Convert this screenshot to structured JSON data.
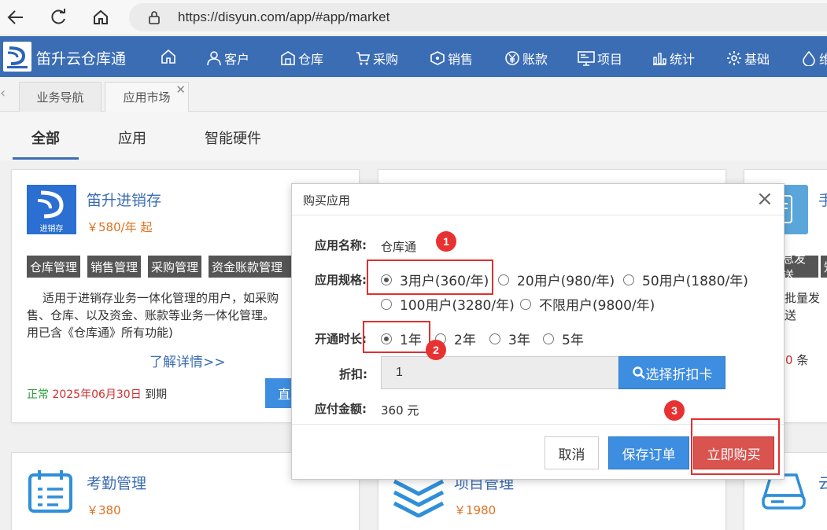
{
  "browser": {
    "url": "https://disyun.com/app/#app/market"
  },
  "header": {
    "brand": "笛升云仓库通",
    "nav": [
      {
        "label": ""
      },
      {
        "label": "客户"
      },
      {
        "label": "仓库"
      },
      {
        "label": "采购"
      },
      {
        "label": "销售"
      },
      {
        "label": "账款"
      },
      {
        "label": "项目"
      },
      {
        "label": "统计"
      },
      {
        "label": "基础"
      },
      {
        "label": "维"
      }
    ]
  },
  "tabs": [
    {
      "label": "业务导航"
    },
    {
      "label": "应用市场"
    }
  ],
  "categories": [
    {
      "label": "全部"
    },
    {
      "label": "应用"
    },
    {
      "label": "智能硬件"
    }
  ],
  "cards": {
    "jxc": {
      "title": "笛升进销存",
      "logo_text": "进销存",
      "price": "￥580/年 起",
      "tags": [
        "仓库管理",
        "销售管理",
        "采购管理",
        "资金账款管理"
      ],
      "desc_lines": [
        "适用于进销存业务一体化管理的用户，如采购",
        "售、仓库、以及资金、账款等业务一体化管理。",
        "用已含《仓库通》所有功能)"
      ],
      "detail": "了解详情>>",
      "status_normal": "正常",
      "status_date": "2025年06月30日",
      "status_suffix": "到期",
      "btn_partial": "直"
    },
    "right_top": {
      "title_partial": "手",
      "tag_partial1": "息发送",
      "tag_partial2": "知",
      "desc_partial": "批量发送",
      "count_num": "0",
      "count_unit": "条"
    },
    "kq": {
      "title": "考勤管理",
      "price": "￥380"
    },
    "xm": {
      "title": "项目管理",
      "price": "￥1980"
    },
    "right_bottom": {
      "title_partial": "云"
    }
  },
  "modal": {
    "title": "购买应用",
    "close": "×",
    "app_name_label": "应用名称:",
    "app_name_value": "仓库通",
    "spec_label": "应用规格:",
    "specs": [
      {
        "label": "3用户(360/年)",
        "checked": true
      },
      {
        "label": "20用户(980/年)",
        "checked": false
      },
      {
        "label": "50用户(1880/年)",
        "checked": false
      },
      {
        "label": "100用户(3280/年)",
        "checked": false
      },
      {
        "label": "不限用户(9800/年)",
        "checked": false
      }
    ],
    "duration_label": "开通时长:",
    "durations": [
      {
        "label": "1年",
        "checked": true
      },
      {
        "label": "2年",
        "checked": false
      },
      {
        "label": "3年",
        "checked": false
      },
      {
        "label": "5年",
        "checked": false
      }
    ],
    "discount_label": "折扣:",
    "discount_value": "1",
    "discount_button": "选择折扣卡",
    "amount_label": "应付金额:",
    "amount_value": "360 元",
    "cancel": "取消",
    "save": "保存订单",
    "buy": "立即购买"
  },
  "annotations": {
    "m1": "1",
    "m2": "2",
    "m3": "3"
  },
  "colors": {
    "brand_blue": "#3b6db4",
    "button_blue": "#3d8de0",
    "buy_red": "#d9534f",
    "price_orange": "#e07020",
    "annotation_red": "#e03030"
  }
}
